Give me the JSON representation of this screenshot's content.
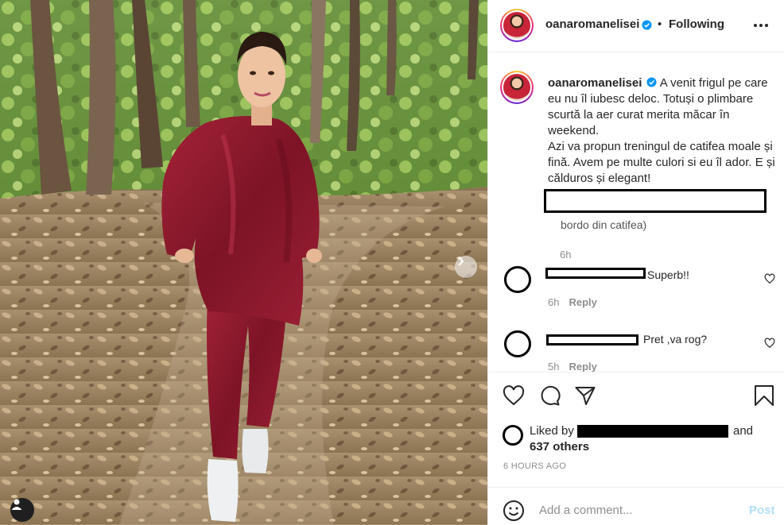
{
  "post": {
    "author": "oanaromanelisei",
    "follow_status": "Following",
    "separator": "•",
    "caption": {
      "line1": "A venit frigul pe care eu nu îl iubesc deloc. Totuși o plimbare scurtă la aer curat merita măcar în weekend.",
      "line2": "Azi va propun treningul de catifea moale și fină. Avem pe multe culori si eu îl ador. E și călduros și elegant!",
      "partial_redacted": "bordo din catifea)",
      "time": "6h"
    },
    "comments": [
      {
        "text": "Superb!!",
        "time": "6h",
        "reply_label": "Reply"
      },
      {
        "text": "Pret ,va rog?",
        "time": "5h",
        "reply_label": "Reply"
      }
    ],
    "likes": {
      "prefix": "Liked by",
      "connector": "and",
      "count_label": "637 others"
    },
    "timestamp": "6 HOURS AGO",
    "comment_box": {
      "placeholder": "Add a comment...",
      "post_label": "Post"
    }
  },
  "icons": {
    "more": "more-options-icon",
    "like": "heart-icon",
    "comment": "comment-icon",
    "share": "paper-plane-icon",
    "save": "bookmark-icon",
    "emoji": "emoji-icon",
    "next": "chevron-right-icon",
    "tag": "user-tag-icon",
    "verified": "verified-badge-icon"
  },
  "colors": {
    "verified_blue": "#0095f6",
    "post_disabled": "#b2dffc",
    "muted_text": "#8e8e8e",
    "velvet_burgundy": "#8d1b2e"
  }
}
